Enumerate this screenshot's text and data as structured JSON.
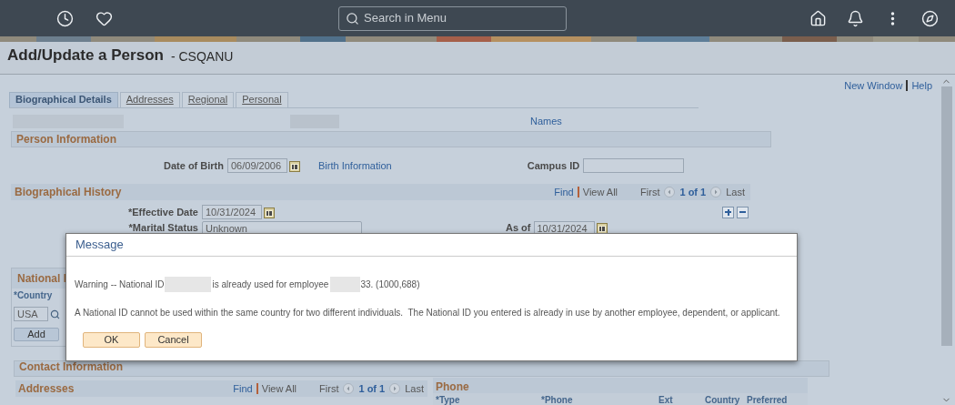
{
  "top_bar": {
    "search": {
      "placeholder": "Search in Menu"
    }
  },
  "page_title": "Add/Update a Person",
  "page_code": "- CSQANU",
  "header_links": [
    "New Window",
    "Help"
  ],
  "tabs": [
    {
      "label": "Biographical Details",
      "selected": true
    },
    {
      "label": "Addresses",
      "selected": false
    },
    {
      "label": "Regional",
      "selected": false
    },
    {
      "label": "Personal",
      "selected": false
    }
  ],
  "names_link": "Names",
  "person_information": {
    "title": "Person Information",
    "date_of_birth": {
      "label": "Date of Birth",
      "value": "06/09/2006"
    },
    "birth_information_link": "Birth Information",
    "campus_id": {
      "label": "Campus ID"
    }
  },
  "biographical_history": {
    "title": "Biographical History",
    "nav": {
      "find": "Find",
      "view_all": "View All",
      "first": "First",
      "count": "1 of 1",
      "last": "Last"
    },
    "effective_date": {
      "label": "*Effective Date",
      "value": "10/31/2024"
    },
    "marital_status": {
      "label": "*Marital Status",
      "value": "Unknown"
    },
    "as_of": {
      "label": "As of",
      "value": "10/31/2024"
    }
  },
  "national_id": {
    "title": "National I",
    "country_label": "*Country",
    "country_value": "USA",
    "add_button": "Add"
  },
  "contact_information": {
    "title": "Contact Information"
  },
  "addresses": {
    "title": "Addresses",
    "nav": {
      "find": "Find",
      "view_all": "View All",
      "first": "First",
      "count": "1 of 1",
      "last": "Last"
    }
  },
  "phone": {
    "title": "Phone",
    "columns": [
      "*Type",
      "*Phone",
      "Ext",
      "Country",
      "Preferred"
    ]
  },
  "message": {
    "title": "Message",
    "warning_parts": [
      "Warning -- National ID",
      "is already used for employee",
      "33. (1000,688)"
    ],
    "detail": "A National ID cannot be used within the same country for two different individuals.  The National ID you entered is already in use by another employee, dependent, or applicant.",
    "buttons": [
      "OK",
      "Cancel"
    ]
  }
}
